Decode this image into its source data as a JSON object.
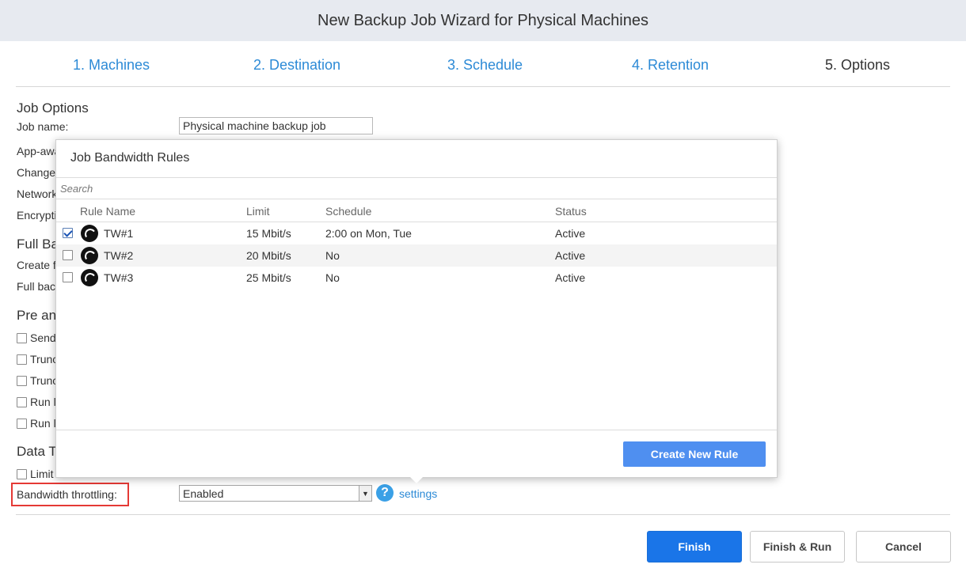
{
  "window_title": "New Backup Job Wizard for Physical Machines",
  "steps": [
    "1. Machines",
    "2. Destination",
    "3. Schedule",
    "4. Retention",
    "5. Options"
  ],
  "job_options": {
    "section_title": "Job Options",
    "job_name_label": "Job name:",
    "job_name_value": "Physical machine backup job",
    "partial_labels": [
      "App-awa",
      "Change",
      "Network",
      "Encrypti"
    ]
  },
  "full_backup": {
    "section_title": "Full Ba",
    "partial_labels": [
      "Create f",
      "Full bac"
    ]
  },
  "pre_post": {
    "section_title": "Pre an",
    "partial_checkbox_labels": [
      "Send",
      "Trunc",
      "Trunc",
      "Run l",
      "Run l"
    ]
  },
  "data_transfer": {
    "section_title": "Data T",
    "limit_label": "Limit",
    "bandwidth_label": "Bandwidth throttling:",
    "bandwidth_value": "Enabled",
    "settings_link": "settings"
  },
  "popup": {
    "title": "Job Bandwidth Rules",
    "search_placeholder": "Search",
    "columns": [
      "Rule Name",
      "Limit",
      "Schedule",
      "Status"
    ],
    "rows": [
      {
        "name": "TW#1",
        "limit": "15 Mbit/s",
        "schedule": "2:00 on Mon, Tue",
        "status": "Active",
        "checked": true
      },
      {
        "name": "TW#2",
        "limit": "20 Mbit/s",
        "schedule": "No",
        "status": "Active",
        "checked": false
      },
      {
        "name": "TW#3",
        "limit": "25 Mbit/s",
        "schedule": "No",
        "status": "Active",
        "checked": false
      }
    ],
    "create_button": "Create New Rule"
  },
  "buttons": {
    "finish": "Finish",
    "finish_run": "Finish & Run",
    "cancel": "Cancel"
  },
  "colors": {
    "link": "#2c8ad6",
    "primary": "#1a75e8",
    "create_rule": "#4f8ff0",
    "highlight_box": "#e53935",
    "titlebar_bg": "#e7eaf0"
  },
  "icons": {
    "help": "help-icon",
    "rule": "bandwidth-rule-icon",
    "dropdown": "chevron-down-icon"
  }
}
